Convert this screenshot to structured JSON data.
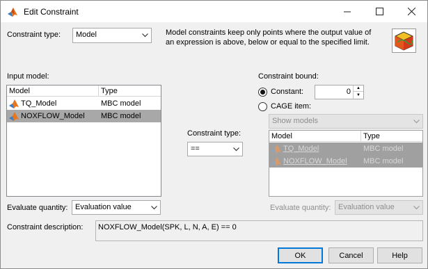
{
  "window": {
    "title": "Edit Constraint",
    "minimize_icon": "minimize-icon",
    "maximize_icon": "maximize-icon",
    "close_icon": "close-icon"
  },
  "constraint_type": {
    "label": "Constraint type:",
    "value": "Model",
    "info": "Model constraints keep only points where the output value of an expression is above, below or equal to the specified limit."
  },
  "input_model": {
    "label": "Input model:",
    "columns": [
      "Model",
      "Type"
    ],
    "rows": [
      {
        "model": "TQ_Model",
        "type": "MBC model",
        "selected": false
      },
      {
        "model": "NOXFLOW_Model",
        "type": "MBC model",
        "selected": true
      }
    ]
  },
  "operator": {
    "label": "Constraint type:",
    "value": "=="
  },
  "bound": {
    "label": "Constraint bound:",
    "constant_label": "Constant:",
    "constant_value": "0",
    "cage_label": "CAGE item:",
    "show_combo": "Show models",
    "columns": [
      "Model",
      "Type"
    ],
    "rows": [
      {
        "model": "TQ_Model",
        "type": "MBC model"
      },
      {
        "model": "NOXFLOW_Model",
        "type": "MBC model"
      }
    ]
  },
  "evaluate_left": {
    "label": "Evaluate quantity:",
    "value": "Evaluation value"
  },
  "evaluate_right": {
    "label": "Evaluate quantity:",
    "value": "Evaluation value"
  },
  "description": {
    "label": "Constraint description:",
    "value": "NOXFLOW_Model(SPK, L, N, A, E) == 0"
  },
  "buttons": {
    "ok": "OK",
    "cancel": "Cancel",
    "help": "Help"
  },
  "colors": {
    "selection": "#a8a8a8",
    "default_button_border": "#0078d7"
  }
}
